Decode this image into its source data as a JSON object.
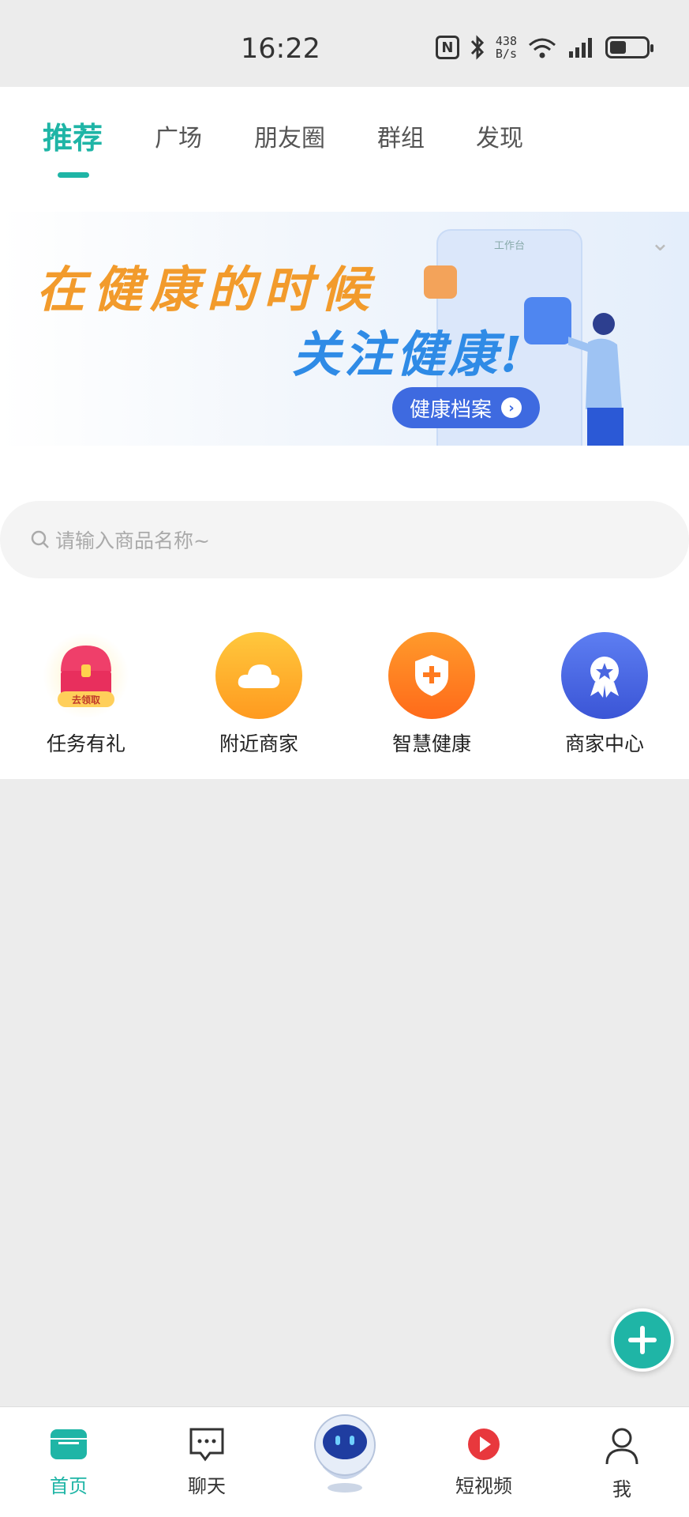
{
  "status_bar": {
    "time": "16:22",
    "nfc": "N",
    "net_speed_value": "438",
    "net_speed_unit": "B/s",
    "signal": "5G",
    "wifi": "6",
    "battery_level": 0.45
  },
  "tabs": [
    {
      "label": "推荐",
      "active": true
    },
    {
      "label": "广场"
    },
    {
      "label": "朋友圈"
    },
    {
      "label": "群组"
    },
    {
      "label": "发现"
    }
  ],
  "banner": {
    "line1": "在健康的时候",
    "line2": "关注健康!",
    "button_label": "健康档案",
    "phone_caption": "工作台"
  },
  "search": {
    "placeholder": "请输入商品名称~"
  },
  "quick_actions": [
    {
      "label": "任务有礼",
      "icon": "treasure-chest-icon",
      "badge": "去领取"
    },
    {
      "label": "附近商家",
      "icon": "cloud-icon"
    },
    {
      "label": "智慧健康",
      "icon": "shield-plus-icon"
    },
    {
      "label": "商家中心",
      "icon": "award-badge-icon"
    }
  ],
  "bottom_nav": [
    {
      "label": "首页",
      "icon": "home-icon",
      "active": true
    },
    {
      "label": "聊天",
      "icon": "chat-icon"
    },
    {
      "label": "",
      "icon": "robot-icon"
    },
    {
      "label": "短视频",
      "icon": "play-icon"
    },
    {
      "label": "我",
      "icon": "user-icon"
    }
  ],
  "colors": {
    "accent": "#1fb5a6",
    "banner_button": "#3e6ae0",
    "background": "#ececec"
  }
}
